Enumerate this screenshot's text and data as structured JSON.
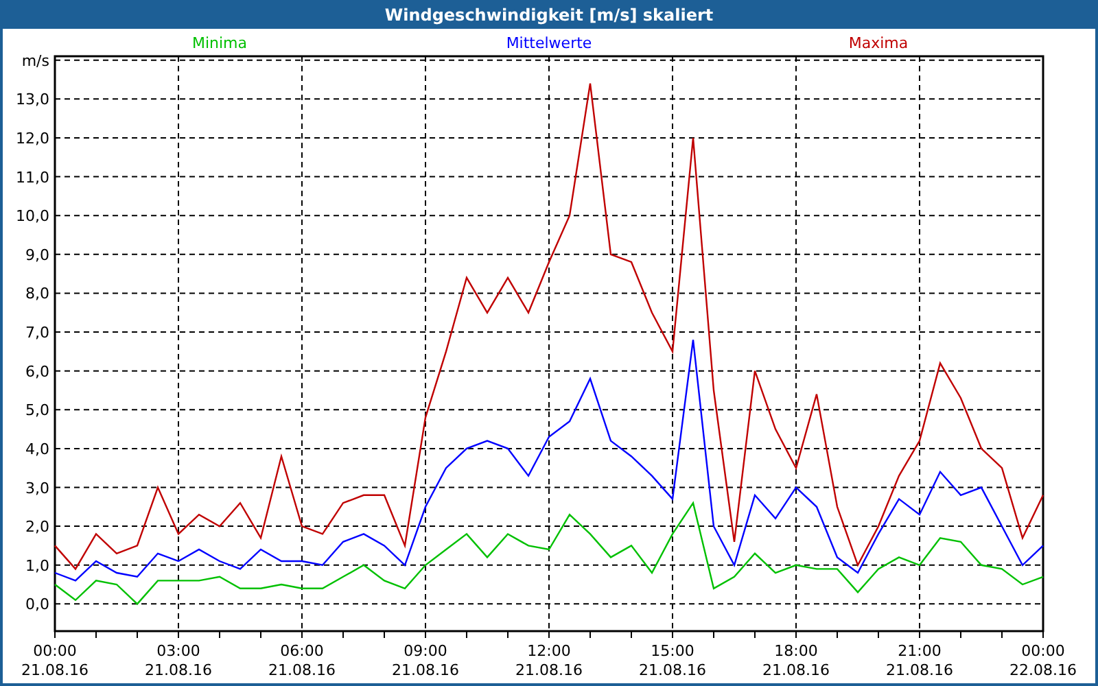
{
  "window": {
    "title": "Windgeschwindigkeit [m/s] skaliert"
  },
  "chart_data": {
    "type": "line",
    "grid": true,
    "ylim": [
      -0.7,
      14.1
    ],
    "categories": [
      "00:00\n21.08.16",
      null,
      null,
      null,
      null,
      null,
      "03:00\n21.08.16",
      null,
      null,
      null,
      null,
      null,
      "06:00\n21.08.16",
      null,
      null,
      null,
      null,
      null,
      "09:00\n21.08.16",
      null,
      null,
      null,
      null,
      null,
      "12:00\n21.08.16",
      null,
      null,
      null,
      null,
      null,
      "15:00\n21.08.16",
      null,
      null,
      null,
      null,
      null,
      "18:00\n21.08.16",
      null,
      null,
      null,
      null,
      null,
      "21:00\n21.08.16",
      null,
      null,
      null,
      null,
      null,
      "00:00\n22.08.16"
    ],
    "yticks": [
      {
        "value": 0,
        "label": "0,0"
      },
      {
        "value": 1,
        "label": "1,0"
      },
      {
        "value": 2,
        "label": "2,0"
      },
      {
        "value": 3,
        "label": "3,0"
      },
      {
        "value": 4,
        "label": "4,0"
      },
      {
        "value": 5,
        "label": "5,0"
      },
      {
        "value": 6,
        "label": "6,0"
      },
      {
        "value": 7,
        "label": "7,0"
      },
      {
        "value": 8,
        "label": "8,0"
      },
      {
        "value": 9,
        "label": "9,0"
      },
      {
        "value": 10,
        "label": "10,0"
      },
      {
        "value": 11,
        "label": "11,0"
      },
      {
        "value": 12,
        "label": "12,0"
      },
      {
        "value": 13,
        "label": "13,0"
      },
      {
        "value": 14,
        "label": "m/s"
      }
    ],
    "series": [
      {
        "name": "Minima",
        "color": "#00c000",
        "values": [
          0.5,
          0.1,
          0.6,
          0.5,
          0.0,
          0.6,
          0.6,
          0.6,
          0.7,
          0.4,
          0.4,
          0.5,
          0.4,
          0.4,
          0.7,
          1.0,
          0.6,
          0.4,
          1.0,
          1.4,
          1.8,
          1.2,
          1.8,
          1.5,
          1.4,
          2.3,
          1.8,
          1.2,
          1.5,
          0.8,
          1.8,
          2.6,
          0.4,
          0.7,
          1.3,
          0.8,
          1.0,
          0.9,
          0.9,
          0.3,
          0.9,
          1.2,
          1.0,
          1.7,
          1.6,
          1.0,
          0.9,
          0.5,
          0.7
        ]
      },
      {
        "name": "Mittelwerte",
        "color": "#0000ff",
        "values": [
          0.8,
          0.6,
          1.1,
          0.8,
          0.7,
          1.3,
          1.1,
          1.4,
          1.1,
          0.9,
          1.4,
          1.1,
          1.1,
          1.0,
          1.6,
          1.8,
          1.5,
          1.0,
          2.5,
          3.5,
          4.0,
          4.2,
          4.0,
          3.3,
          4.3,
          4.7,
          5.8,
          4.2,
          3.8,
          3.3,
          2.7,
          6.8,
          2.0,
          1.0,
          2.8,
          2.2,
          3.0,
          2.5,
          1.2,
          0.8,
          1.8,
          2.7,
          2.3,
          3.4,
          2.8,
          3.0,
          2.0,
          1.0,
          1.5
        ]
      },
      {
        "name": "Maxima",
        "color": "#c00000",
        "values": [
          1.5,
          0.9,
          1.8,
          1.3,
          1.5,
          3.0,
          1.8,
          2.3,
          2.0,
          2.6,
          1.7,
          3.8,
          2.0,
          1.8,
          2.6,
          2.8,
          2.8,
          1.5,
          4.8,
          6.5,
          8.4,
          7.5,
          8.4,
          7.5,
          8.8,
          10.0,
          13.4,
          9.0,
          8.8,
          7.5,
          6.5,
          12.0,
          5.5,
          1.6,
          6.0,
          4.5,
          3.5,
          5.4,
          2.5,
          1.0,
          2.0,
          3.3,
          4.2,
          6.2,
          5.3,
          4.0,
          3.5,
          1.7,
          2.8
        ]
      }
    ]
  }
}
